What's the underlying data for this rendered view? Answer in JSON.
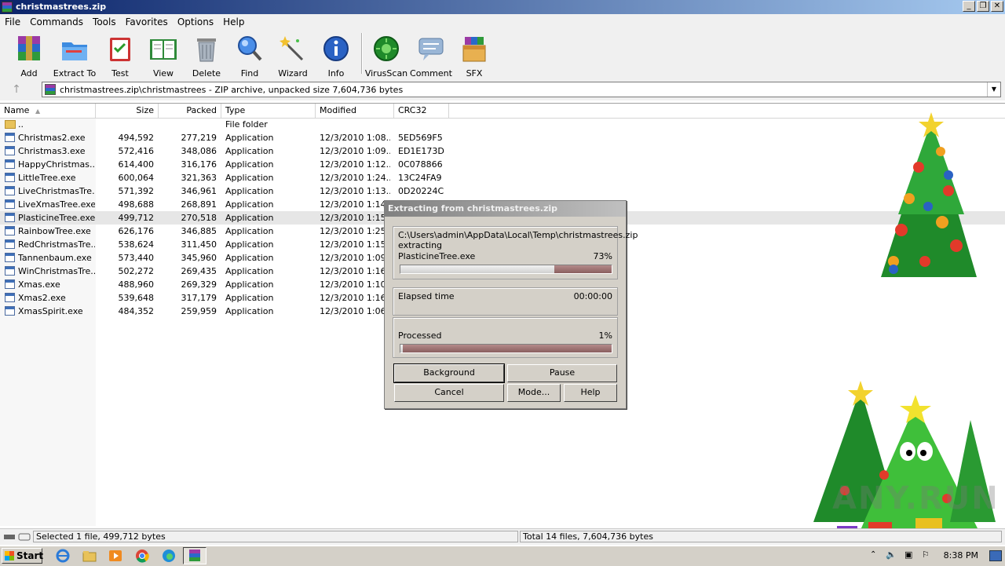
{
  "window": {
    "title": "christmastrees.zip"
  },
  "menu": [
    "File",
    "Commands",
    "Tools",
    "Favorites",
    "Options",
    "Help"
  ],
  "toolbar": [
    {
      "label": "Add",
      "icon": "add-archive-icon"
    },
    {
      "label": "Extract To",
      "icon": "extract-to-icon"
    },
    {
      "label": "Test",
      "icon": "test-icon"
    },
    {
      "label": "View",
      "icon": "view-book-icon"
    },
    {
      "label": "Delete",
      "icon": "delete-bin-icon"
    },
    {
      "label": "Find",
      "icon": "find-magnifier-icon"
    },
    {
      "label": "Wizard",
      "icon": "wizard-wand-icon"
    },
    {
      "label": "Info",
      "icon": "info-icon"
    },
    {
      "label": "VirusScan",
      "icon": "virus-scan-icon"
    },
    {
      "label": "Comment",
      "icon": "comment-icon"
    },
    {
      "label": "SFX",
      "icon": "sfx-icon"
    }
  ],
  "address": {
    "path": "christmastrees.zip\\christmastrees - ZIP archive, unpacked size 7,604,736 bytes"
  },
  "columns": {
    "name": "Name",
    "size": "Size",
    "packed": "Packed",
    "type": "Type",
    "modified": "Modified",
    "crc": "CRC32"
  },
  "files": [
    {
      "name": "..",
      "size": "",
      "packed": "",
      "type": "File folder",
      "modified": "",
      "crc": "",
      "folder": true
    },
    {
      "name": "Christmas2.exe",
      "size": "494,592",
      "packed": "277,219",
      "type": "Application",
      "modified": "12/3/2010 1:08...",
      "crc": "5ED569F5"
    },
    {
      "name": "Christmas3.exe",
      "size": "572,416",
      "packed": "348,086",
      "type": "Application",
      "modified": "12/3/2010 1:09...",
      "crc": "ED1E173D"
    },
    {
      "name": "HappyChristmas....",
      "size": "614,400",
      "packed": "316,176",
      "type": "Application",
      "modified": "12/3/2010 1:12...",
      "crc": "0C078866"
    },
    {
      "name": "LittleTree.exe",
      "size": "600,064",
      "packed": "321,363",
      "type": "Application",
      "modified": "12/3/2010 1:24...",
      "crc": "13C24FA9"
    },
    {
      "name": "LiveChristmasTre...",
      "size": "571,392",
      "packed": "346,961",
      "type": "Application",
      "modified": "12/3/2010 1:13...",
      "crc": "0D20224C"
    },
    {
      "name": "LiveXmasTree.exe",
      "size": "498,688",
      "packed": "268,891",
      "type": "Application",
      "modified": "12/3/2010 1:14.",
      "crc": ""
    },
    {
      "name": "PlasticineTree.exe",
      "size": "499,712",
      "packed": "270,518",
      "type": "Application",
      "modified": "12/3/2010 1:15.",
      "crc": "",
      "selected": true
    },
    {
      "name": "RainbowTree.exe",
      "size": "626,176",
      "packed": "346,885",
      "type": "Application",
      "modified": "12/3/2010 1:25.",
      "crc": ""
    },
    {
      "name": "RedChristmasTre...",
      "size": "538,624",
      "packed": "311,450",
      "type": "Application",
      "modified": "12/3/2010 1:15.",
      "crc": ""
    },
    {
      "name": "Tannenbaum.exe",
      "size": "573,440",
      "packed": "345,960",
      "type": "Application",
      "modified": "12/3/2010 1:09.",
      "crc": ""
    },
    {
      "name": "WinChristmasTre...",
      "size": "502,272",
      "packed": "269,435",
      "type": "Application",
      "modified": "12/3/2010 1:16.",
      "crc": ""
    },
    {
      "name": "Xmas.exe",
      "size": "488,960",
      "packed": "269,329",
      "type": "Application",
      "modified": "12/3/2010 1:10.",
      "crc": ""
    },
    {
      "name": "Xmas2.exe",
      "size": "539,648",
      "packed": "317,179",
      "type": "Application",
      "modified": "12/3/2010 1:16.",
      "crc": ""
    },
    {
      "name": "XmasSpirit.exe",
      "size": "484,352",
      "packed": "259,959",
      "type": "Application",
      "modified": "12/3/2010 1:06.",
      "crc": ""
    }
  ],
  "status": {
    "left": "Selected 1 file, 499,712 bytes",
    "right": "Total 14 files, 7,604,736 bytes"
  },
  "dialog": {
    "title": "Extracting from christmastrees.zip",
    "path": "C:\\Users\\admin\\AppData\\Local\\Temp\\christmastrees.zip",
    "action": "extracting",
    "file": "PlasticineTree.exe",
    "file_percent": "73%",
    "file_progress": 0.73,
    "elapsed_label": "Elapsed time",
    "elapsed_value": "00:00:00",
    "processed_label": "Processed",
    "processed_percent": "1%",
    "processed_progress": 0.01,
    "buttons": {
      "background": "Background",
      "pause": "Pause",
      "cancel": "Cancel",
      "mode": "Mode...",
      "help": "Help"
    }
  },
  "taskbar": {
    "start": "Start",
    "time": "8:38 PM"
  },
  "watermark": "ANY.RUN"
}
